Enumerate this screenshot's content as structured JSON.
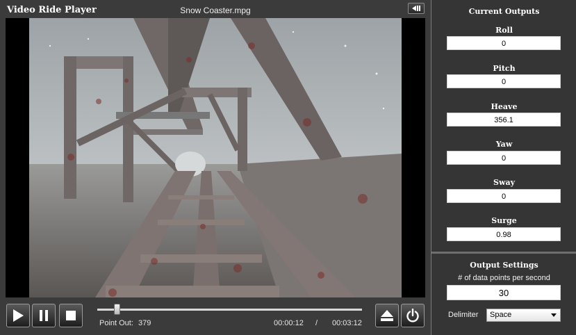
{
  "app_title": "Video Ride Player",
  "file_name": "Snow Coaster.mpg",
  "controls": {
    "point_out_label": "Point Out:",
    "point_out_value": "379",
    "current_time": "00:00:12",
    "time_separator": "/",
    "total_time": "00:03:12"
  },
  "outputs": {
    "title": "Current Outputs",
    "fields": [
      {
        "label": "Roll",
        "value": "0"
      },
      {
        "label": "Pitch",
        "value": "0"
      },
      {
        "label": "Heave",
        "value": "356.1"
      },
      {
        "label": "Yaw",
        "value": "0"
      },
      {
        "label": "Sway",
        "value": "0"
      },
      {
        "label": "Surge",
        "value": "0.98"
      }
    ]
  },
  "settings": {
    "title": "Output Settings",
    "rate_label": "# of data points per second",
    "rate_value": "30",
    "delimiter_label": "Delimiter",
    "delimiter_value": "Space"
  },
  "icons": {
    "play": "play-icon",
    "pause": "pause-icon",
    "stop": "stop-icon",
    "eject": "eject-icon",
    "power": "power-icon",
    "collapse": "collapse-panel-icon"
  }
}
